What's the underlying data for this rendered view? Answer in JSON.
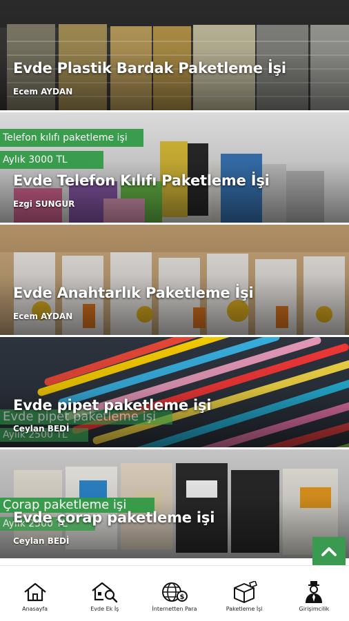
{
  "posts": [
    {
      "title": "Evde Plastik Bardak Paketleme İşi",
      "author": "Ecem AYDAN",
      "banners": []
    },
    {
      "title": "Evde Telefon Kılıfı Paketleme İşi",
      "author": "Ezgi SUNGUR",
      "banners": [
        "Telefon kılıfı paketleme işi",
        "Aylık 3000 TL"
      ]
    },
    {
      "title": "Evde Anahtarlık Paketleme İşi",
      "author": "Ecem AYDAN",
      "banners": []
    },
    {
      "title": "Evde pipet paketleme işi",
      "author": "Ceylan BEDİ",
      "banners": [
        "Evde pipet paketleme işi",
        "Aylık 2500 TL"
      ]
    },
    {
      "title": "Evde çorap paketleme işi",
      "author": "Ceylan BEDİ",
      "banners": [
        "Çorap paketleme işi",
        "Aylık 2500 TL"
      ]
    }
  ],
  "bottom_nav": [
    {
      "label": "Anasayfa",
      "icon": "home-icon"
    },
    {
      "label": "Evde Ek İş",
      "icon": "house-search-icon"
    },
    {
      "label": "İnternetten Para",
      "icon": "globe-money-icon"
    },
    {
      "label": "Paketleme İşi",
      "icon": "package-box-icon"
    },
    {
      "label": "Girişimcilik",
      "icon": "entrepreneur-icon"
    }
  ],
  "scroll_top": {
    "icon": "chevron-up-icon"
  },
  "colors": {
    "accent": "#2f9a44",
    "scroll_button": "#3a9a4f"
  }
}
